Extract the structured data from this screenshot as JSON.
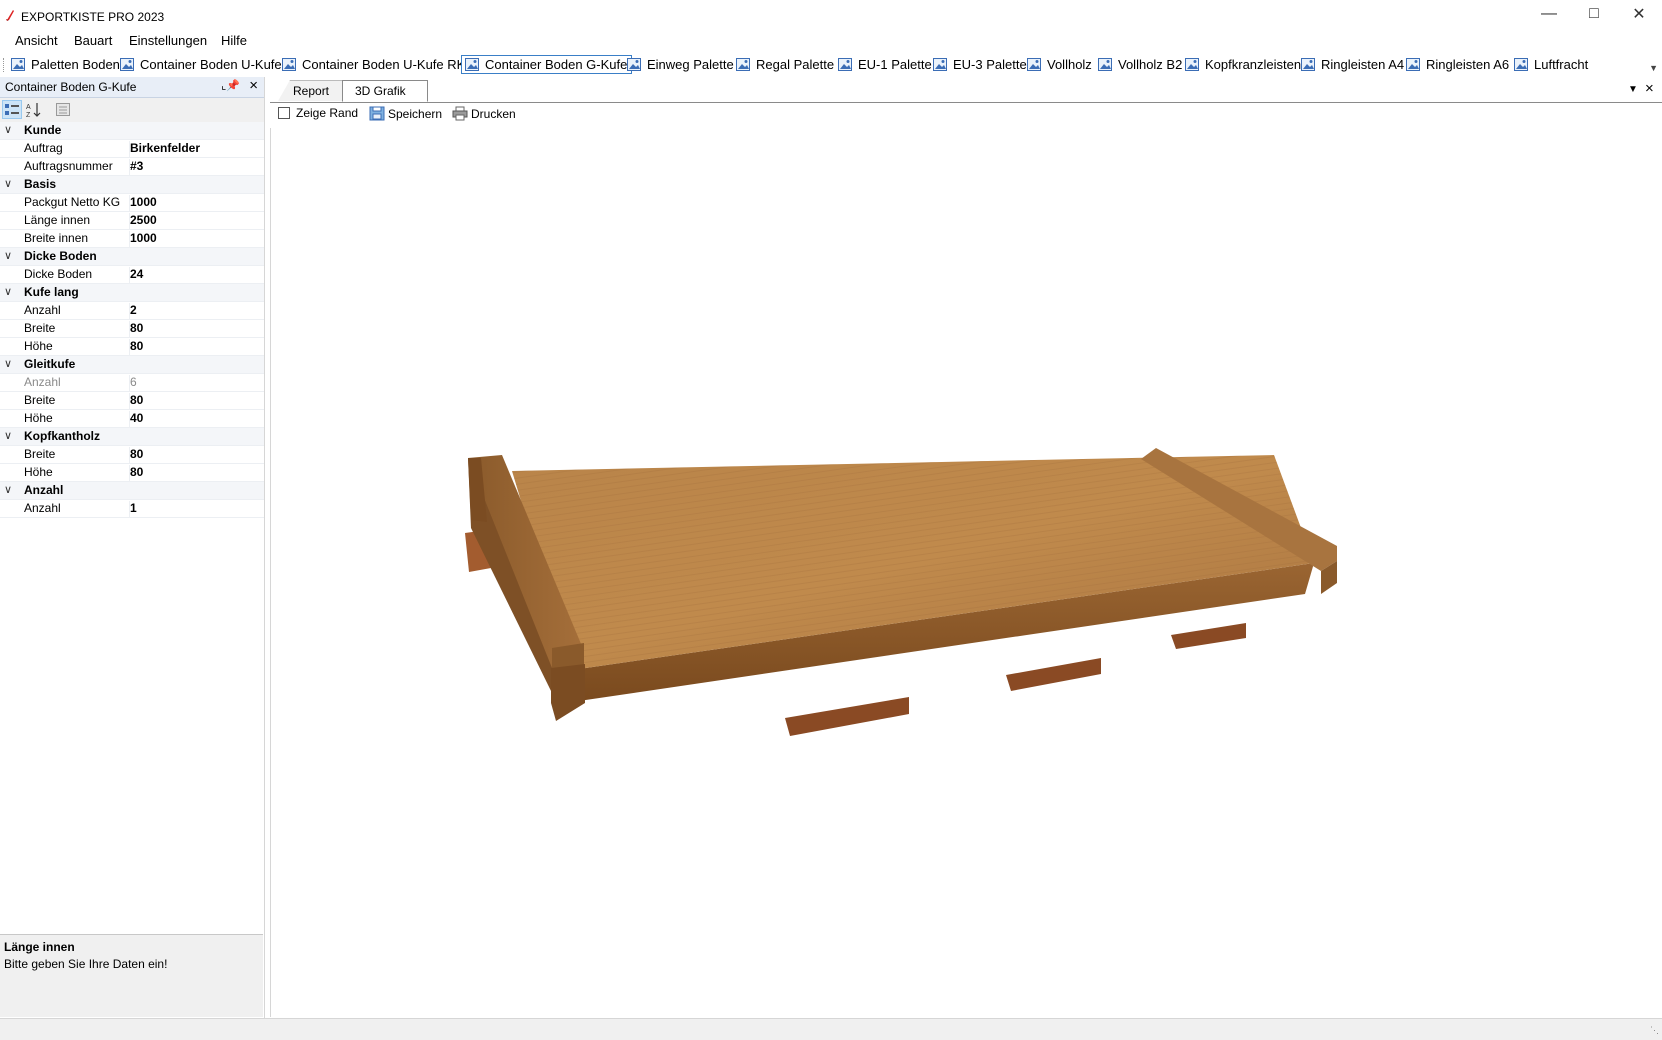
{
  "window": {
    "title": "EXPORTKISTE PRO 2023"
  },
  "menu": [
    "Ansicht",
    "Bauart",
    "Einstellungen",
    "Hilfe"
  ],
  "toolbar": {
    "items": [
      {
        "label": "Paletten Boden",
        "active": false
      },
      {
        "label": "Container Boden U-Kufe",
        "active": false
      },
      {
        "label": "Container Boden U-Kufe RK",
        "active": false
      },
      {
        "label": "Container Boden G-Kufe",
        "active": true
      },
      {
        "label": "Einweg Palette",
        "active": false
      },
      {
        "label": "Regal Palette",
        "active": false
      },
      {
        "label": "EU-1 Palette",
        "active": false
      },
      {
        "label": "EU-3 Palette",
        "active": false
      },
      {
        "label": "Vollholz",
        "active": false
      },
      {
        "label": "Vollholz B2",
        "active": false
      },
      {
        "label": "Kopfkranzleisten",
        "active": false
      },
      {
        "label": "Ringleisten A4",
        "active": false
      },
      {
        "label": "Ringleisten A6",
        "active": false
      },
      {
        "label": "Luftfracht",
        "active": false
      }
    ]
  },
  "panel": {
    "title": "Container Boden G-Kufe",
    "categories": [
      {
        "name": "Kunde",
        "rows": [
          {
            "name": "Auftrag",
            "value": "Birkenfelder",
            "disabled": false
          },
          {
            "name": "Auftragsnummer",
            "value": "#3",
            "disabled": false
          }
        ]
      },
      {
        "name": "Basis",
        "rows": [
          {
            "name": "Packgut Netto KG",
            "value": "1000",
            "disabled": false
          },
          {
            "name": "Länge innen",
            "value": "2500",
            "disabled": false
          },
          {
            "name": "Breite innen",
            "value": "1000",
            "disabled": false
          }
        ]
      },
      {
        "name": "Dicke Boden",
        "rows": [
          {
            "name": "Dicke Boden",
            "value": "24",
            "disabled": false
          }
        ]
      },
      {
        "name": "Kufe lang",
        "rows": [
          {
            "name": "Anzahl",
            "value": "2",
            "disabled": false
          },
          {
            "name": "Breite",
            "value": "80",
            "disabled": false
          },
          {
            "name": "Höhe",
            "value": "80",
            "disabled": false
          }
        ]
      },
      {
        "name": "Gleitkufe",
        "rows": [
          {
            "name": "Anzahl",
            "value": "6",
            "disabled": true
          },
          {
            "name": "Breite",
            "value": "80",
            "disabled": false
          },
          {
            "name": "Höhe",
            "value": "40",
            "disabled": false
          }
        ]
      },
      {
        "name": "Kopfkantholz",
        "rows": [
          {
            "name": "Breite",
            "value": "80",
            "disabled": false
          },
          {
            "name": "Höhe",
            "value": "80",
            "disabled": false
          }
        ]
      },
      {
        "name": "Anzahl",
        "rows": [
          {
            "name": "Anzahl",
            "value": "1",
            "disabled": false
          }
        ]
      }
    ],
    "help": {
      "title": "Länge innen",
      "text": "Bitte geben Sie Ihre Daten ein!"
    }
  },
  "tabs": {
    "report": "Report",
    "grafik": "3D Grafik"
  },
  "view": {
    "show_edge": "Zeige Rand",
    "save": "Speichern",
    "print": "Drucken"
  }
}
